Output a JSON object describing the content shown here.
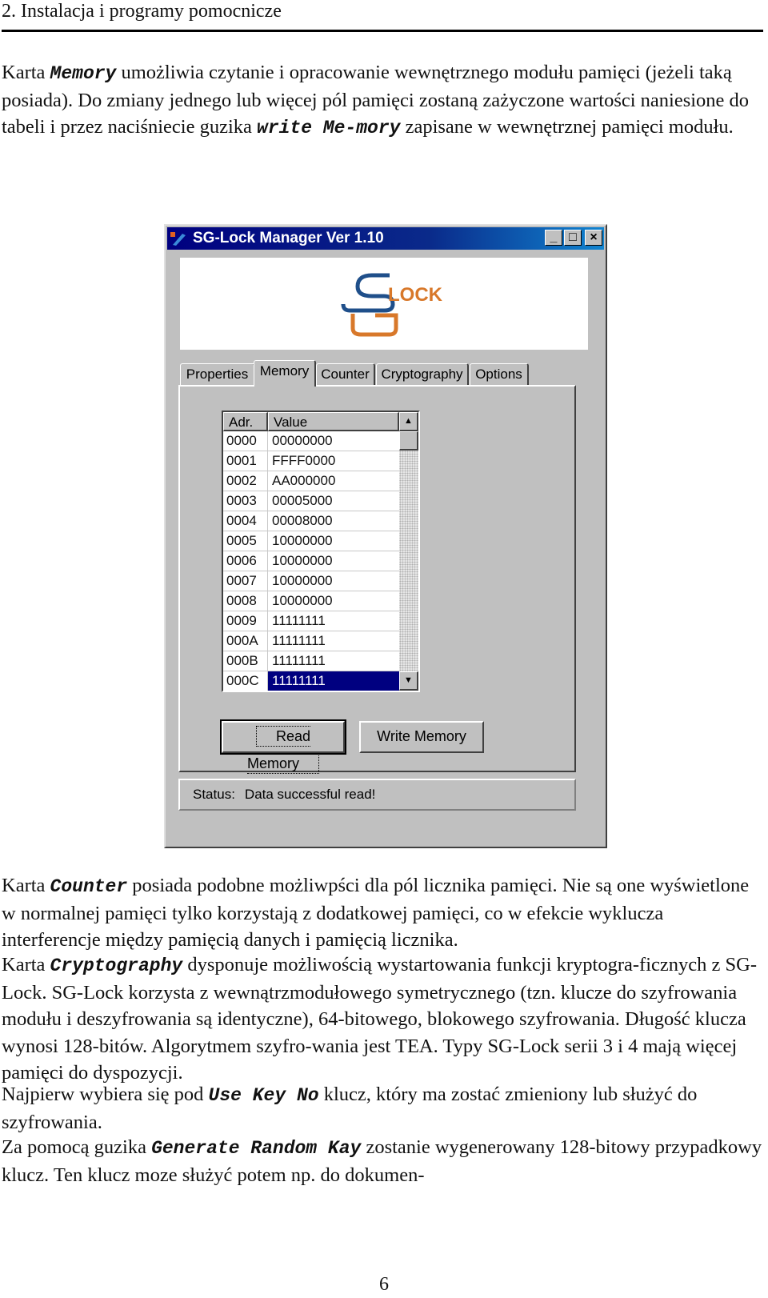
{
  "header": {
    "title": "2. Instalacja i programy pomocnicze"
  },
  "intro": {
    "p1_a": "Karta ",
    "p1_mono1": "Memory",
    "p1_b": "  umożliwia czytanie i opracowanie wewnętrznego modułu pamięci (jeżeli taką posiada). Do zmiany  jednego lub więcej pól pamięci zostaną zażyczone wartości  naniesione do tabeli i przez naciśniecie guzika ",
    "p1_mono2": "write Me-mory",
    "p1_c": "  zapisane w wewnętrznej pamięci modułu."
  },
  "window": {
    "title": "SG-Lock Manager Ver 1.10",
    "controls": {
      "minimize": "_",
      "maximize": "□",
      "close": "×"
    },
    "logo": {
      "letters": "SG",
      "text": "LOCK",
      "color_blue": "#1f4f8a",
      "color_orange": "#d8782a"
    },
    "tabs": [
      {
        "label": "Properties",
        "active": false
      },
      {
        "label": "Memory",
        "active": true
      },
      {
        "label": "Counter",
        "active": false
      },
      {
        "label": "Cryptography",
        "active": false
      },
      {
        "label": "Options",
        "active": false
      }
    ],
    "memory_table": {
      "columns": [
        "Adr.",
        "Value"
      ],
      "rows": [
        {
          "adr": "0000",
          "value": "00000000"
        },
        {
          "adr": "0001",
          "value": "FFFF0000"
        },
        {
          "adr": "0002",
          "value": "AA000000"
        },
        {
          "adr": "0003",
          "value": "00005000"
        },
        {
          "adr": "0004",
          "value": "00008000"
        },
        {
          "adr": "0005",
          "value": "10000000"
        },
        {
          "adr": "0006",
          "value": "10000000"
        },
        {
          "adr": "0007",
          "value": "10000000"
        },
        {
          "adr": "0008",
          "value": "10000000"
        },
        {
          "adr": "0009",
          "value": "11111111"
        },
        {
          "adr": "000A",
          "value": "11111111"
        },
        {
          "adr": "000B",
          "value": "11111111"
        },
        {
          "adr": "000C",
          "value": "11111111",
          "selected": true
        }
      ]
    },
    "buttons": {
      "read": "Read Memory",
      "write": "Write Memory"
    },
    "status": {
      "label": "Status:",
      "text": "Data successful read!"
    },
    "colors": {
      "titlebar": "#000080",
      "selection": "#000080",
      "face": "#c0c0c0"
    }
  },
  "body": {
    "p2_a": "Karta ",
    "p2_mono1": "Counter",
    "p2_b": " posiada podobne możliwpści dla pól licznika pamięci. Nie są one wyświetlone w normalnej pamięci tylko korzystają z dodatkowej pamięci, co w efekcie wyklucza interferencje między pamięcią danych i pamięcią licznika.",
    "p3_a": "Karta ",
    "p3_mono1": "Cryptography",
    "p3_b": "  dysponuje możliwością wystartowania funkcji kryptogra-ficznych  z  SG-Lock. SG-Lock korzysta z wewnątrzmodułowego symetrycznego (tzn. klucze do szyfrowania modułu  i deszyfrowania są identyczne), 64-bitowego, blokowego szyfrowania. Długość klucza wynosi  128-bitów. Algorytmem szyfro-wania jest TEA. Typy SG-Lock serii  3 i 4 mają więcej pamięci do dyspozycji.",
    "p4_a": "Najpierw wybiera się pod  ",
    "p4_mono1": "Use Key No",
    "p4_b": "  klucz, który ma zostać zmieniony lub służyć do szyfrowania.",
    "p5_a": "Za pomocą guzika  ",
    "p5_mono1": "Generate Random Kay",
    "p5_b": "  zostanie wygenerowany 128-bitowy przypadkowy klucz. Ten klucz moze służyć potem  np. do dokumen-"
  },
  "footer": {
    "page_number": "6"
  }
}
